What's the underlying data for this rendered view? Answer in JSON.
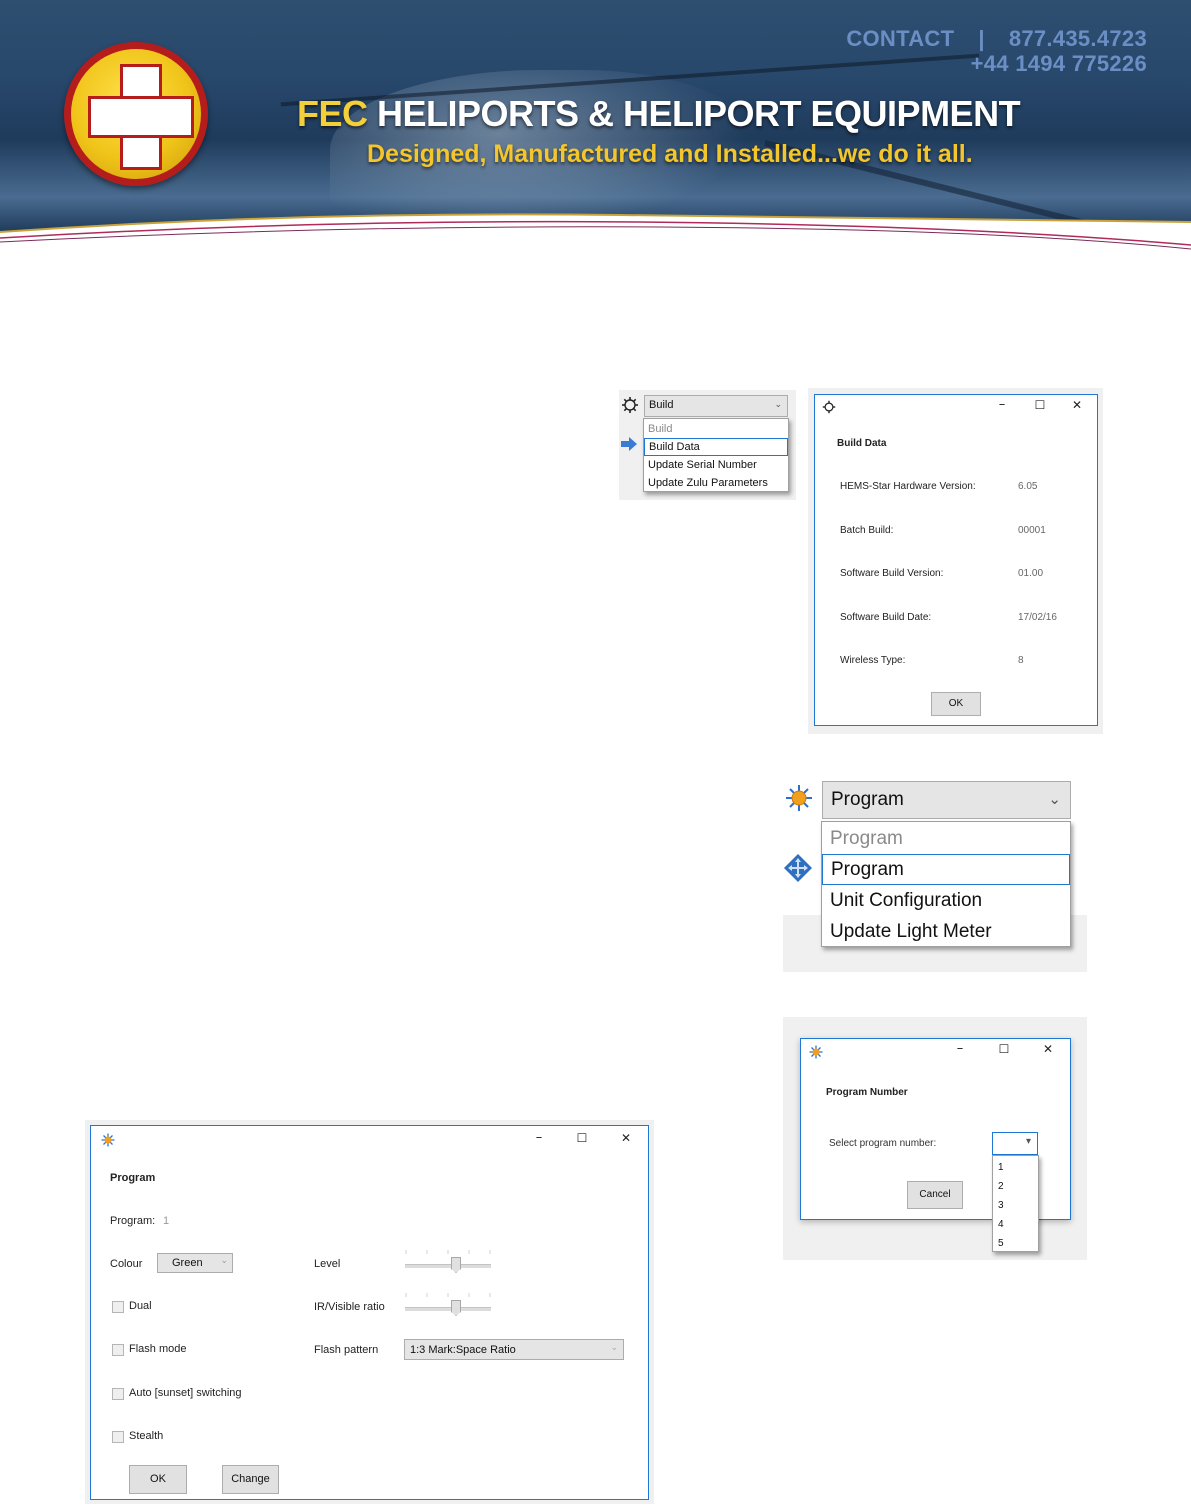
{
  "header": {
    "contact_label": "CONTACT",
    "contact_separator": "|",
    "phone_us": "877.435.4723",
    "phone_uk": "+44 1494 775226",
    "company_prefix": "FEC",
    "company_suffix": "HELIPORTS & HELIPORT EQUIPMENT",
    "tagline": "Designed, Manufactured and Installed...we do it all."
  },
  "build_menu": {
    "selected": "Build",
    "items": [
      {
        "label": "Build",
        "disabled": true
      },
      {
        "label": "Build Data",
        "highlighted": true
      },
      {
        "label": "Update Serial Number"
      },
      {
        "label": "Update Zulu Parameters"
      }
    ]
  },
  "build_data_dialog": {
    "heading": "Build Data",
    "rows": [
      {
        "label": "HEMS-Star Hardware Version:",
        "value": "6.05"
      },
      {
        "label": "Batch Build:",
        "value": "00001"
      },
      {
        "label": "Software Build Version:",
        "value": "01.00"
      },
      {
        "label": "Software Build Date:",
        "value": "17/02/16"
      },
      {
        "label": "Wireless Type:",
        "value": "8"
      }
    ],
    "ok_label": "OK"
  },
  "program_menu": {
    "selected": "Program",
    "items": [
      {
        "label": "Program",
        "disabled": true
      },
      {
        "label": "Program",
        "highlighted": true
      },
      {
        "label": "Unit Configuration"
      },
      {
        "label": "Update Light Meter"
      }
    ]
  },
  "program_number_dialog": {
    "heading": "Program Number",
    "prompt": "Select program number:",
    "options": [
      "1",
      "2",
      "3",
      "4",
      "5"
    ],
    "cancel_label": "Cancel"
  },
  "program_dialog": {
    "heading": "Program",
    "program_label": "Program:",
    "program_value": "1",
    "colour_label": "Colour",
    "colour_value": "Green",
    "level_label": "Level",
    "level_fraction": 0.6,
    "ir_label": "IR/Visible ratio",
    "ir_fraction": 0.6,
    "dual_label": "Dual",
    "flash_mode_label": "Flash mode",
    "flash_pattern_label": "Flash pattern",
    "flash_pattern_value": "1:3 Mark:Space Ratio",
    "auto_label": "Auto [sunset] switching",
    "stealth_label": "Stealth",
    "ok_label": "OK",
    "change_label": "Change"
  },
  "window_controls": {
    "minimize": "–",
    "maximize": "☐",
    "close": "✕"
  },
  "colors": {
    "accent": "#1e77d3",
    "brand_yellow": "#f3cf3a",
    "brand_red": "#b51d1d",
    "banner_blue": "#27476b"
  }
}
